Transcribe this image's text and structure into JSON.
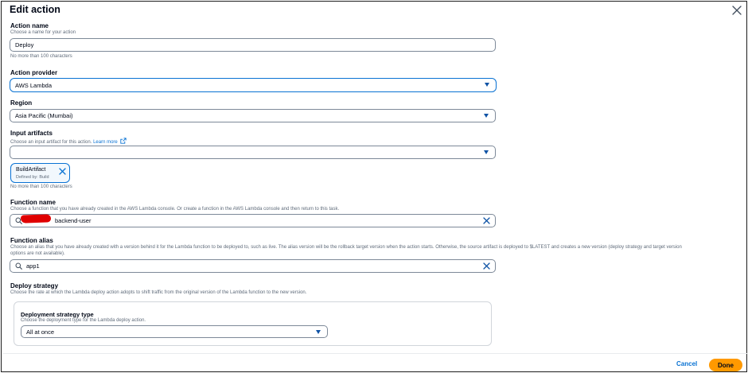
{
  "dialog": {
    "title": "Edit action"
  },
  "action_name": {
    "label": "Action name",
    "description": "Choose a name for your action",
    "value": "Deploy",
    "hint": "No more than 100 characters"
  },
  "action_provider": {
    "label": "Action provider",
    "value": "AWS Lambda"
  },
  "region": {
    "label": "Region",
    "value": "Asia Pacific (Mumbai)"
  },
  "input_artifacts": {
    "label": "Input artifacts",
    "description": "Choose an input artifact for this action.",
    "learn_more": "Learn more",
    "value": "",
    "token": {
      "name": "BuildArtifact",
      "defined_by": "Defined by: Build"
    },
    "hint": "No more than 100 characters"
  },
  "function_name": {
    "label": "Function name",
    "description": "Choose a function that you have already created in the AWS Lambda console. Or create a function in the AWS Lambda console and then return to this task.",
    "value": "backend-user"
  },
  "function_alias": {
    "label": "Function alias",
    "description_line1": "Choose an alias that you have already created with a version behind it for the Lambda function to be deployed to, such as live. The alias version will be the rollback target version when the action starts. Otherwise, the source artifact is deployed to $LATEST and creates a new version (deploy strategy and target version",
    "description_line2": "options are not available).",
    "value": "app1"
  },
  "deploy_strategy": {
    "label": "Deploy strategy",
    "description": "Choose the rate at which the Lambda deploy action adopts to shift traffic from the original version of the Lambda function to the new version.",
    "type_label": "Deployment strategy type",
    "type_description": "Choose the deployment type for the Lambda deploy action.",
    "type_value": "All at once"
  },
  "footer": {
    "cancel_label": "Cancel",
    "done_label": "Done"
  },
  "colors": {
    "primary_link": "#0972d3",
    "done_button": "#ff9900",
    "redaction": "#e00000"
  },
  "icons": [
    "close-icon",
    "caret-down-icon",
    "external-link-icon",
    "search-icon",
    "clear-icon",
    "dismiss-icon"
  ]
}
